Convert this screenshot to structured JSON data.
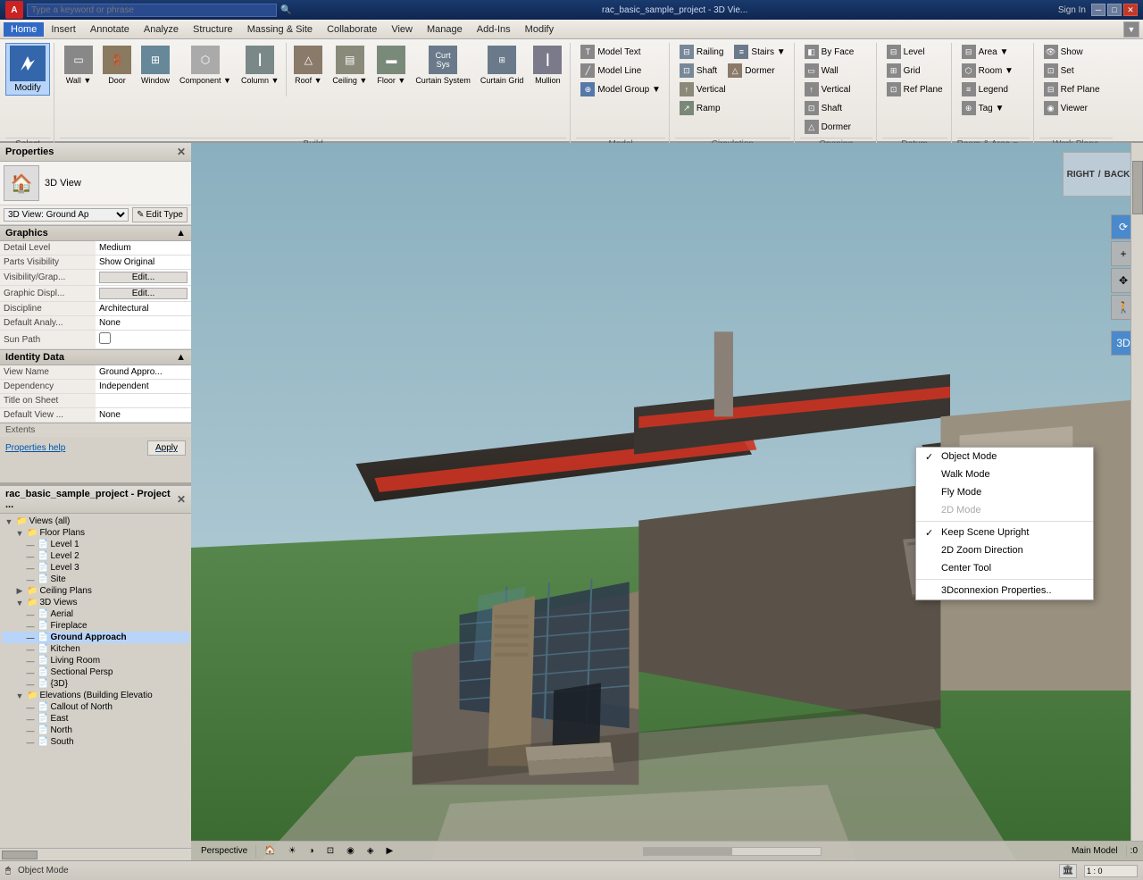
{
  "titlebar": {
    "app_name": "rac_basic_sample_project - 3D Vie...",
    "search_placeholder": "Type a keyword or phrase",
    "sign_in": "Sign In",
    "help": "?"
  },
  "menubar": {
    "items": [
      "Home",
      "Insert",
      "Annotate",
      "Analyze",
      "Structure",
      "Massing & Site",
      "Collaborate",
      "View",
      "Manage",
      "Add-Ins",
      "Modify"
    ]
  },
  "ribbon": {
    "active_tab": "Home",
    "groups": [
      {
        "name": "Select",
        "items": [
          {
            "label": "Modify",
            "icon": "✦"
          }
        ]
      },
      {
        "name": "Build",
        "items": [
          {
            "label": "Wall",
            "icon": "▭"
          },
          {
            "label": "Door",
            "icon": "⊡"
          },
          {
            "label": "Window",
            "icon": "⊞"
          },
          {
            "label": "Component",
            "icon": "⬡"
          },
          {
            "label": "Column",
            "icon": "┃"
          },
          {
            "label": "Roof",
            "icon": "△"
          },
          {
            "label": "Ceiling",
            "icon": "▤"
          },
          {
            "label": "Floor",
            "icon": "▬"
          },
          {
            "label": "Curtain System",
            "icon": "⊟"
          },
          {
            "label": "Curtain Grid",
            "icon": "⊞"
          },
          {
            "label": "Mullion",
            "icon": "┃"
          }
        ]
      },
      {
        "name": "Model",
        "items": [
          {
            "label": "Model Text",
            "icon": "T"
          },
          {
            "label": "Model Line",
            "icon": "╱"
          },
          {
            "label": "Model Group",
            "icon": "⊕"
          }
        ]
      },
      {
        "name": "Circulation",
        "items": [
          {
            "label": "Railing",
            "icon": "⊟"
          },
          {
            "label": "Shaft",
            "icon": "⊡"
          },
          {
            "label": "Vertical",
            "icon": "↑"
          },
          {
            "label": "Ramp",
            "icon": "↗"
          },
          {
            "label": "Stairs",
            "icon": "≡"
          },
          {
            "label": "Dormer",
            "icon": "△"
          }
        ]
      },
      {
        "name": "Opening",
        "items": [
          {
            "label": "By Face",
            "icon": "◧"
          },
          {
            "label": "Wall",
            "icon": "▭"
          },
          {
            "label": "Vertical",
            "icon": "↑"
          },
          {
            "label": "Shaft",
            "icon": "⊡"
          },
          {
            "label": "Dormer",
            "icon": "△"
          }
        ]
      },
      {
        "name": "Datum",
        "items": [
          {
            "label": "Level",
            "icon": "⊟"
          },
          {
            "label": "Grid",
            "icon": "⊞"
          },
          {
            "label": "Ref Plane",
            "icon": "⊡"
          }
        ]
      },
      {
        "name": "Room & Area",
        "items": [
          {
            "label": "Area",
            "icon": "⊟"
          },
          {
            "label": "Room",
            "icon": "⬡"
          },
          {
            "label": "Legend",
            "icon": "≡"
          },
          {
            "label": "Tag",
            "icon": "⊕"
          }
        ]
      },
      {
        "name": "Work Plane",
        "items": [
          {
            "label": "Show",
            "icon": "👁"
          },
          {
            "label": "Set",
            "icon": "⊡"
          },
          {
            "label": "Ref Plane",
            "icon": "⊟"
          },
          {
            "label": "Viewer",
            "icon": "◉"
          }
        ]
      }
    ]
  },
  "properties": {
    "title": "Properties",
    "view_type": "3D View",
    "view_name_label": "3D View: Ground Ap",
    "edit_type_label": "Edit Type",
    "sections": [
      {
        "name": "Graphics",
        "rows": [
          {
            "label": "Detail Level",
            "value": "Medium"
          },
          {
            "label": "Parts Visibility",
            "value": "Show Original"
          },
          {
            "label": "Visibility/Grap...",
            "value": "Edit..."
          },
          {
            "label": "Graphic Displ...",
            "value": "Edit..."
          },
          {
            "label": "Discipline",
            "value": "Architectural"
          },
          {
            "label": "Default Analy...",
            "value": "None"
          },
          {
            "label": "Sun Path",
            "value": "☐"
          }
        ]
      },
      {
        "name": "Identity Data",
        "rows": [
          {
            "label": "View Name",
            "value": "Ground Appro..."
          },
          {
            "label": "Dependency",
            "value": "Independent"
          },
          {
            "label": "Title on Sheet",
            "value": ""
          },
          {
            "label": "Default View ...",
            "value": "None"
          }
        ]
      }
    ],
    "properties_help": "Properties help",
    "apply_label": "Apply"
  },
  "project_browser": {
    "title": "rac_basic_sample_project - Project ...",
    "tree": [
      {
        "level": 0,
        "label": "Views (all)",
        "expanded": true,
        "icon": "📁"
      },
      {
        "level": 1,
        "label": "Floor Plans",
        "expanded": true,
        "icon": "📁"
      },
      {
        "level": 2,
        "label": "Level 1",
        "icon": "📄"
      },
      {
        "level": 2,
        "label": "Level 2",
        "icon": "📄"
      },
      {
        "level": 2,
        "label": "Level 3",
        "icon": "📄"
      },
      {
        "level": 2,
        "label": "Site",
        "icon": "📄"
      },
      {
        "level": 1,
        "label": "Ceiling Plans",
        "expanded": false,
        "icon": "📁"
      },
      {
        "level": 1,
        "label": "3D Views",
        "expanded": true,
        "icon": "📁"
      },
      {
        "level": 2,
        "label": "Aerial",
        "icon": "📄"
      },
      {
        "level": 2,
        "label": "Fireplace",
        "icon": "📄"
      },
      {
        "level": 2,
        "label": "Ground Approach",
        "selected": true,
        "icon": "📄"
      },
      {
        "level": 2,
        "label": "Kitchen",
        "icon": "📄"
      },
      {
        "level": 2,
        "label": "Living Room",
        "icon": "📄"
      },
      {
        "level": 2,
        "label": "Sectional Persp",
        "icon": "📄"
      },
      {
        "level": 2,
        "label": "{3D}",
        "icon": "📄"
      },
      {
        "level": 1,
        "label": "Elevations (Building Elevatio",
        "expanded": true,
        "icon": "📁"
      },
      {
        "level": 2,
        "label": "Callout of North",
        "icon": "📄"
      },
      {
        "level": 2,
        "label": "East",
        "icon": "📄"
      },
      {
        "level": 2,
        "label": "North",
        "icon": "📄"
      },
      {
        "level": 2,
        "label": "South",
        "icon": "📄"
      }
    ]
  },
  "viewport": {
    "view_name": "Perspective",
    "nav_cube": {
      "right": "RIGHT",
      "back": "BACK"
    },
    "bottom_bar": {
      "view_type": "Perspective",
      "coords": ":0",
      "model": "Main Model",
      "scale": "1:0"
    }
  },
  "context_menu": {
    "items": [
      {
        "label": "Object Mode",
        "checked": true,
        "disabled": false
      },
      {
        "label": "Walk Mode",
        "checked": false,
        "disabled": false
      },
      {
        "label": "Fly Mode",
        "checked": false,
        "disabled": false
      },
      {
        "label": "2D Mode",
        "checked": false,
        "disabled": true
      },
      {
        "separator": true
      },
      {
        "label": "Keep Scene Upright",
        "checked": true,
        "disabled": false
      },
      {
        "label": "2D Zoom Direction",
        "checked": false,
        "disabled": false
      },
      {
        "label": "Center Tool",
        "checked": false,
        "disabled": false
      },
      {
        "separator": true
      },
      {
        "label": "3Dconnexion Properties..",
        "checked": false,
        "disabled": false
      }
    ]
  },
  "statusbar": {
    "mode": "Object Mode",
    "icon": "🖱"
  }
}
